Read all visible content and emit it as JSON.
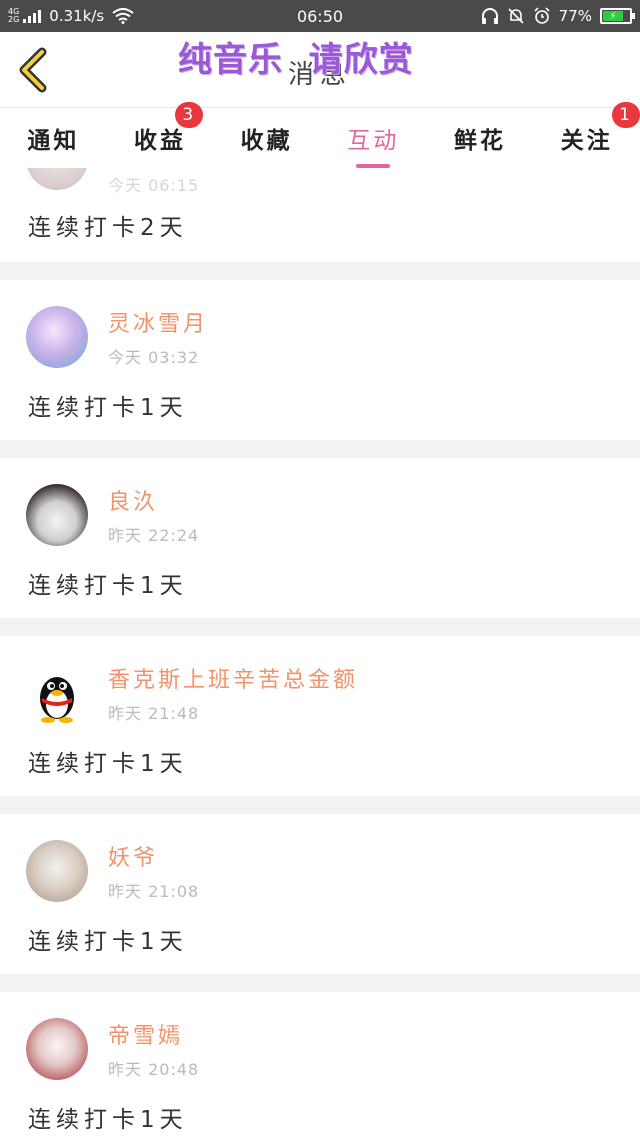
{
  "status_bar": {
    "network_top": "4G",
    "network_bottom": "2G",
    "speed": "0.31k/s",
    "time": "06:50",
    "battery": "77%"
  },
  "header": {
    "title": "消息",
    "overlay_text": "纯音乐  请欣赏"
  },
  "tabs": [
    {
      "label": "通知",
      "badge": ""
    },
    {
      "label": "收益",
      "badge": "3"
    },
    {
      "label": "收藏",
      "badge": ""
    },
    {
      "label": "互动",
      "badge": "",
      "active": true
    },
    {
      "label": "鲜花",
      "badge": ""
    },
    {
      "label": "关注",
      "badge": "1"
    }
  ],
  "items": [
    {
      "name": "",
      "time": "今天 06:15",
      "content": "连续打卡2天"
    },
    {
      "name": "灵冰雪月",
      "time": "今天 03:32",
      "content": "连续打卡1天"
    },
    {
      "name": "良汣",
      "time": "昨天 22:24",
      "content": "连续打卡1天"
    },
    {
      "name": "香克斯上班辛苦总金额",
      "time": "昨天 21:48",
      "content": "连续打卡1天"
    },
    {
      "name": "妖爷",
      "time": "昨天 21:08",
      "content": "连续打卡1天"
    },
    {
      "name": "帝雪嫣",
      "time": "昨天 20:48",
      "content": "连续打卡1天"
    }
  ],
  "colors": {
    "accent": "#e0679c",
    "name": "#f0936a",
    "badge": "#e8383d",
    "overlay": "#9b59d6"
  }
}
